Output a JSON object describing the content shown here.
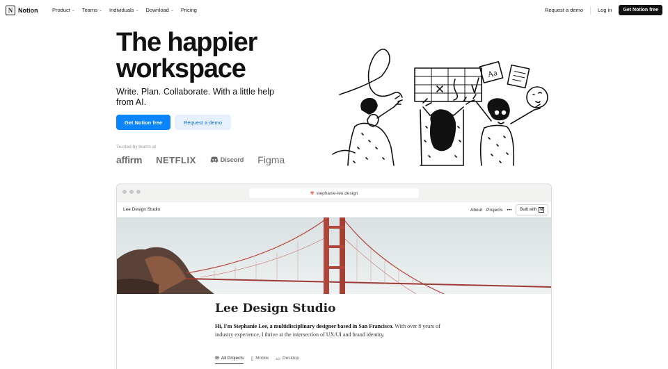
{
  "nav": {
    "brand": "Notion",
    "links": [
      {
        "label": "Product",
        "chevron": true
      },
      {
        "label": "Teams",
        "chevron": true
      },
      {
        "label": "Individuals",
        "chevron": true
      },
      {
        "label": "Download",
        "chevron": true
      },
      {
        "label": "Pricing",
        "chevron": false
      }
    ],
    "request_demo": "Request a demo",
    "login": "Log in",
    "cta": "Get Notion free"
  },
  "hero": {
    "title_line1": "The happier",
    "title_line2": "workspace",
    "subtitle": "Write. Plan. Collaborate. With a little help from AI.",
    "primary_button": "Get Notion free",
    "secondary_button": "Request a demo",
    "trusted_label": "Trusted by teams at",
    "brands": [
      "affirm",
      "NETFLIX",
      "Discord",
      "Figma"
    ]
  },
  "browser": {
    "url": "stephanie-lee.design",
    "site_name": "Lee Design Studio",
    "site_links": [
      "About",
      "Projects",
      "•••"
    ],
    "built_with": "Built with",
    "page_title": "Lee Design Studio",
    "intro_bold": "Hi, I'm Stephanie Lee, a multidisciplinary designer based in San Francisco.",
    "intro_rest": " With over 8 years of industry experience, I thrive at the intersection of UX/UI and brand identity.",
    "tabs": [
      {
        "label": "All Projects",
        "icon": "grid-icon",
        "active": true
      },
      {
        "label": "Mobile",
        "icon": "phone-icon",
        "active": false
      },
      {
        "label": "Desktop",
        "icon": "monitor-icon",
        "active": false
      }
    ]
  },
  "colors": {
    "accent_blue": "#0a85ff",
    "demo_bg": "#e6f1fd",
    "bridge_red": "#b8453a"
  }
}
